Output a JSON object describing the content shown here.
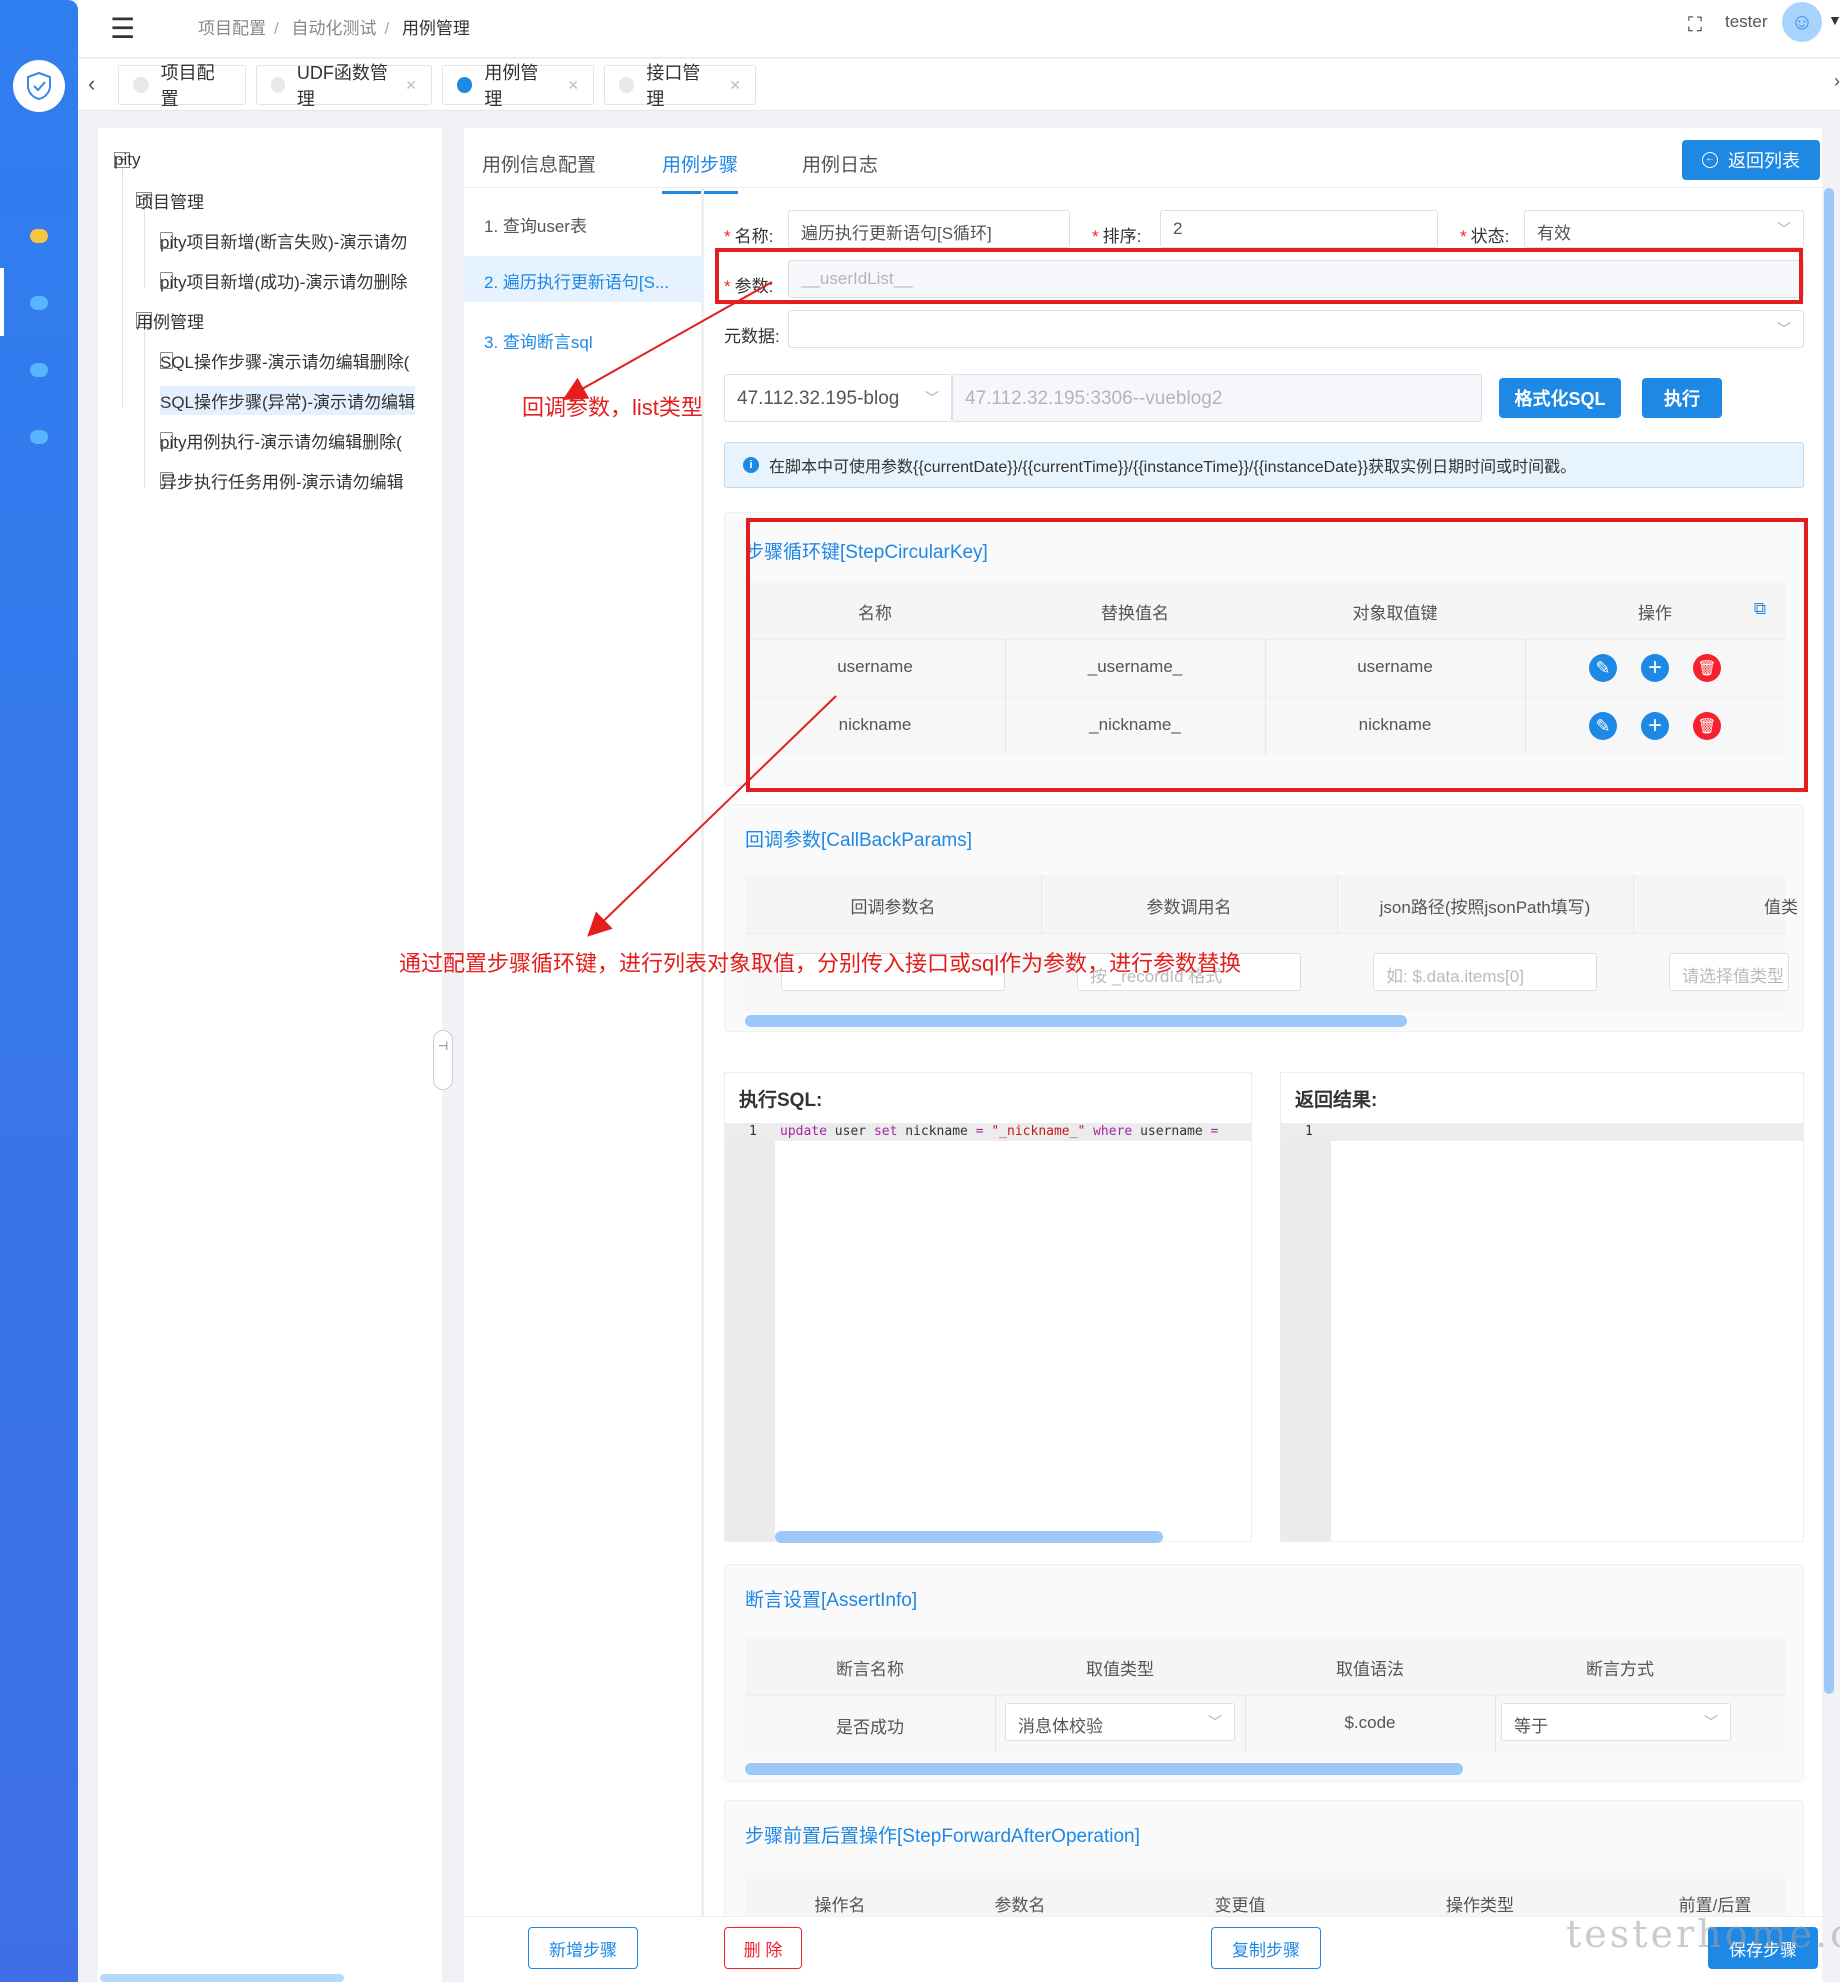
{
  "topbar": {
    "breadcrumb": [
      "项目配置",
      "自动化测试",
      "用例管理"
    ],
    "user": "tester"
  },
  "tabs": [
    {
      "label": "项目配置",
      "active": false
    },
    {
      "label": "UDF函数管理",
      "active": false
    },
    {
      "label": "用例管理",
      "active": true
    },
    {
      "label": "接口管理",
      "active": false
    }
  ],
  "tree": {
    "root": "pity",
    "groups": [
      {
        "label": "项目管理",
        "items": [
          "pity项目新增(断言失败)-演示请勿",
          "pity项目新增(成功)-演示请勿删除"
        ]
      },
      {
        "label": "用例管理",
        "items": [
          "SQL操作步骤-演示请勿编辑删除(",
          "SQL操作步骤(异常)-演示请勿编辑",
          "pity用例执行-演示请勿编辑删除(",
          "异步执行任务用例-演示请勿编辑"
        ]
      }
    ],
    "selected_item": "SQL操作步骤(异常)-演示请勿编辑"
  },
  "main_tabs": [
    "用例信息配置",
    "用例步骤",
    "用例日志"
  ],
  "active_main_tab": "用例步骤",
  "back_list_label": "返回列表",
  "steps": [
    "1. 查询user表",
    "2. 遍历执行更新语句[S...",
    "3. 查询断言sql"
  ],
  "form": {
    "name_label": "名称:",
    "name_value": "遍历执行更新语句[S循环]",
    "order_label": "排序:",
    "order_value": "2",
    "status_label": "状态:",
    "status_value": "有效",
    "param_label": "参数:",
    "param_value": "__userIdList__",
    "meta_label": "元数据:",
    "meta_value": "",
    "db_select": "47.112.32.195-blog",
    "db_value": "47.112.32.195:3306--vueblog2",
    "format_sql_label": "格式化SQL",
    "execute_label": "执行",
    "alert": "在脚本中可使用参数{{currentDate}}/{{currentTime}}/{{instanceTime}}/{{instanceDate}}获取实例日期时间或时间戳。"
  },
  "circular": {
    "title": "步骤循环键[StepCircularKey]",
    "headers": [
      "名称",
      "替换值名",
      "对象取值键",
      "操作"
    ],
    "rows": [
      [
        "username",
        "_username_",
        "username"
      ],
      [
        "nickname",
        "_nickname_",
        "nickname"
      ]
    ]
  },
  "callback": {
    "title": "回调参数[CallBackParams]",
    "headers": [
      "回调参数名",
      "参数调用名",
      "json路径(按照jsonPath填写)",
      "值类"
    ],
    "placeholders": [
      "",
      "按 _recordId 格式",
      "如: $.data.items[0]",
      "请选择值类型"
    ]
  },
  "sql_editor": {
    "title": "执行SQL:",
    "line_no": "1",
    "code": {
      "kw1": "update",
      "t1": " user ",
      "kw2": "set",
      "t2": " nickname ",
      "op1": "=",
      "s1": " \"_nickname_\" ",
      "kw3": "where",
      "t3": " username ",
      "op2": "="
    }
  },
  "result_editor": {
    "title": "返回结果:",
    "line_no": "1"
  },
  "assert": {
    "title": "断言设置[AssertInfo]",
    "headers": [
      "断言名称",
      "取值类型",
      "取值语法",
      "断言方式"
    ],
    "row": [
      "是否成功",
      "消息体校验",
      "$.code",
      "等于"
    ]
  },
  "forward_after": {
    "title": "步骤前置后置操作[StepForwardAfterOperation]",
    "headers": [
      "操作名",
      "参数名",
      "变更值",
      "操作类型",
      "前置/后置"
    ]
  },
  "buttons": {
    "add_step": "新增步骤",
    "delete": "删 除",
    "copy_step": "复制步骤",
    "save_step": "保存步骤"
  },
  "annotations": {
    "a1": "回调参数，list类型",
    "a2": "通过配置步骤循环键，进行列表对象取值，分别传入接口或sql作为参数，进行参数替换"
  },
  "watermark": "testerhome.com",
  "colors": {
    "accent": "#1e88e5",
    "danger": "#f5222d",
    "annotation": "#e41e1e"
  }
}
